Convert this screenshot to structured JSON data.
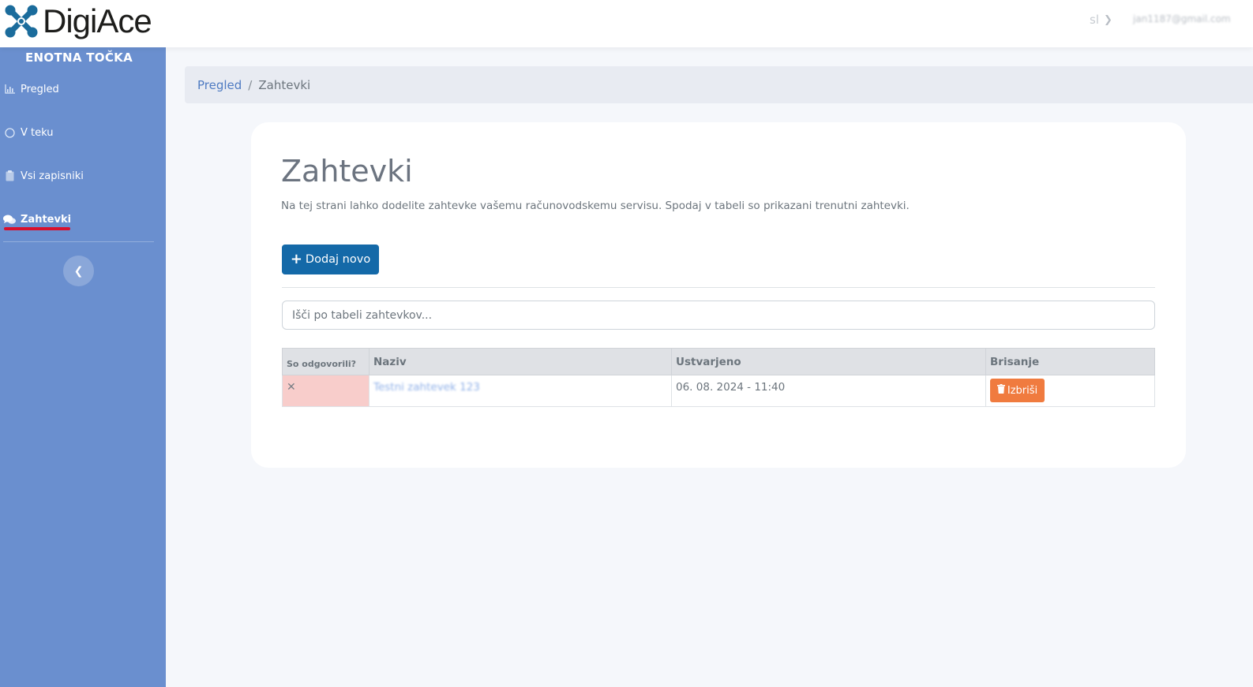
{
  "app": {
    "logo_text": "DigiAce"
  },
  "header": {
    "language": "sl",
    "user_email": "jan1187@gmail.com"
  },
  "sidebar": {
    "title": "ENOTNA TOČKA",
    "items": [
      {
        "label": "Pregled",
        "icon": "chart-icon",
        "active": false
      },
      {
        "label": "V teku",
        "icon": "circle-icon",
        "active": false
      },
      {
        "label": "Vsi zapisniki",
        "icon": "clipboard-icon",
        "active": false
      },
      {
        "label": "Zahtevki",
        "icon": "comments-icon",
        "active": true
      }
    ],
    "collapse_icon": "chevron-left-icon"
  },
  "breadcrumb": {
    "home": "Pregled",
    "separator": "/",
    "current": "Zahtevki"
  },
  "main": {
    "title": "Zahtevki",
    "description": "Na tej strani lahko dodelite zahtevke vašemu računovodskemu servisu. Spodaj v tabeli so prikazani trenutni zahtevki.",
    "add_button": "Dodaj novo",
    "search_placeholder": "Išči po tabeli zahtevkov...",
    "table": {
      "columns": [
        "So odgovorili?",
        "Naziv",
        "Ustvarjeno",
        "Brisanje"
      ],
      "rows": [
        {
          "answered": "✕",
          "name": "Testni zahtevek 123",
          "created": "06. 08. 2024 - 11:40",
          "delete_label": "Izbriši"
        }
      ]
    }
  },
  "colors": {
    "sidebar": "#6a8fcf",
    "primary": "#1469a8",
    "danger": "#f07b3f",
    "unanswered": "#f8cdcb",
    "link": "#4f7bc2"
  }
}
